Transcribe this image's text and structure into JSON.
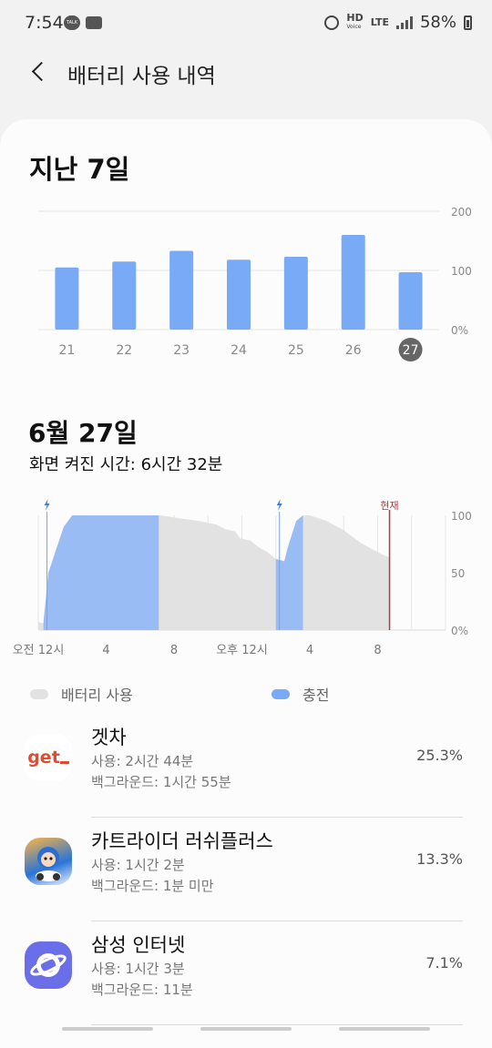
{
  "status": {
    "time": "7:54",
    "talk_badge": "TALK",
    "hd": "HD",
    "voice": "Voice",
    "lte": "LTE",
    "battery": "58%"
  },
  "header": {
    "title": "배터리 사용 내역"
  },
  "week": {
    "title": "지난 7일",
    "selected_day": "27"
  },
  "day": {
    "title": "6월 27일",
    "screen_time": "화면 켜진 시간: 6시간 32분",
    "now_label": "현재"
  },
  "legend": {
    "usage": "배터리 사용",
    "charging": "충전"
  },
  "apps": [
    {
      "name": "겟차",
      "usage": "사용: 2시간 44분",
      "background": "백그라운드: 1시간 55분",
      "percent": "25.3%",
      "icon_text": "get",
      "icon": "getcha-icon"
    },
    {
      "name": "카트라이더 러쉬플러스",
      "usage": "사용: 1시간 2분",
      "background": "백그라운드: 1분 미만",
      "percent": "13.3%",
      "icon": "kartrider-icon"
    },
    {
      "name": "삼성 인터넷",
      "usage": "사용: 1시간 3분",
      "background": "백그라운드: 11분",
      "percent": "7.1%",
      "icon": "samsung-internet-icon"
    }
  ],
  "chart_data": [
    {
      "type": "bar",
      "categories": [
        "21",
        "22",
        "23",
        "24",
        "25",
        "26",
        "27"
      ],
      "values": [
        105,
        115,
        133,
        118,
        123,
        160,
        97
      ],
      "ylim": [
        0,
        200
      ],
      "yticks": [
        "0%",
        "100",
        "200"
      ],
      "grid": true,
      "color": "#79aaf5"
    },
    {
      "type": "area",
      "x_ticks": [
        "오전 12시",
        "4",
        "8",
        "오후 12시",
        "4",
        "8"
      ],
      "y_ticks": [
        "0%",
        "50",
        "100"
      ],
      "ylim": [
        0,
        100
      ],
      "x_unit": "hours",
      "xlim": [
        0,
        24
      ],
      "now_hour": 20.7,
      "charging_markers": [
        0.3,
        14.0
      ],
      "battery_level": [
        [
          0,
          7
        ],
        [
          0.3,
          6
        ],
        [
          0.6,
          50
        ],
        [
          1.0,
          68
        ],
        [
          1.5,
          90
        ],
        [
          2.0,
          100
        ],
        [
          7.1,
          100
        ],
        [
          7.2,
          100
        ],
        [
          8.5,
          97
        ],
        [
          9.5,
          95
        ],
        [
          10.5,
          92
        ],
        [
          11.0,
          88
        ],
        [
          11.6,
          86
        ],
        [
          11.9,
          80
        ],
        [
          12.5,
          78
        ],
        [
          13.0,
          72
        ],
        [
          13.5,
          68
        ],
        [
          14.0,
          62
        ],
        [
          14.5,
          60
        ],
        [
          14.7,
          72
        ],
        [
          15.2,
          95
        ],
        [
          15.6,
          100
        ],
        [
          16.0,
          100
        ],
        [
          17.0,
          95
        ],
        [
          18.0,
          87
        ],
        [
          19.0,
          76
        ],
        [
          20.0,
          68
        ],
        [
          20.7,
          63
        ]
      ],
      "charging_ranges": [
        [
          0.3,
          7.1
        ],
        [
          14.0,
          15.6
        ]
      ],
      "colors": {
        "usage": "#e2e2e2",
        "charging": "#9abcf5",
        "now": "#b13a3a"
      }
    }
  ]
}
